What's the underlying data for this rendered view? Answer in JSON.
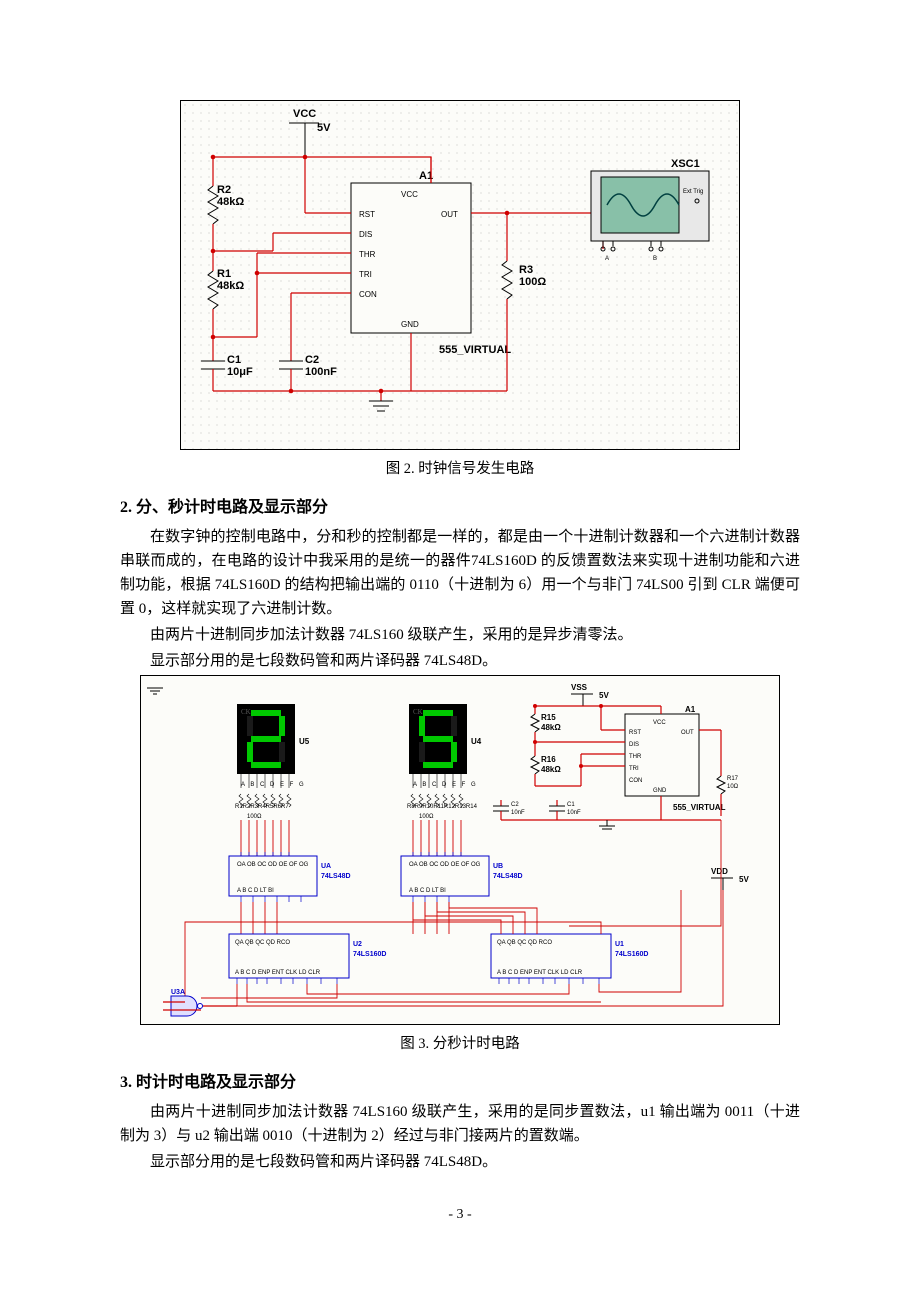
{
  "fig1": {
    "vcc": "VCC",
    "vcc_val": "5V",
    "r2_name": "R2",
    "r2_val": "48kΩ",
    "r1_name": "R1",
    "r1_val": "48kΩ",
    "c1_name": "C1",
    "c1_val": "10μF",
    "c2_name": "C2",
    "c2_val": "100nF",
    "a1": "A1",
    "r3_name": "R3",
    "r3_val": "100Ω",
    "chip_vcc": "VCC",
    "chip_rst": "RST",
    "chip_out": "OUT",
    "chip_dis": "DIS",
    "chip_thr": "THR",
    "chip_tri": "TRI",
    "chip_con": "CON",
    "chip_gnd": "GND",
    "chip_model": "555_VIRTUAL",
    "scope": "XSC1",
    "scope_ext": "Ext Trig",
    "scope_a": "A",
    "scope_b": "B",
    "caption": "图 2. 时钟信号发生电路"
  },
  "sec2": {
    "heading": "2. 分、秒计时电路及显示部分",
    "p1": "在数字钟的控制电路中，分和秒的控制都是一样的，都是由一个十进制计数器和一个六进制计数器串联而成的，在电路的设计中我采用的是统一的器件74LS160D 的反馈置数法来实现十进制功能和六进制功能，根据 74LS160D 的结构把输出端的 0110（十进制为 6）用一个与非门 74LS00 引到 CLR 端便可置 0，这样就实现了六进制计数。",
    "p2": "由两片十进制同步加法计数器 74LS160 级联产生，采用的是异步清零法。",
    "p3": "显示部分用的是七段数码管和两片译码器 74LS48D。"
  },
  "fig2": {
    "vss": "VSS",
    "vss_val": "5V",
    "vdd": "VDD",
    "vdd_val": "5V",
    "u5": "U5",
    "u4": "U4",
    "r15_name": "R15",
    "r15_val": "48kΩ",
    "r16_name": "R16",
    "r16_val": "48kΩ",
    "r17": "R17",
    "r17_val": "10Ω",
    "a1": "A1",
    "c1_name": "C1",
    "c1_val": "10nF",
    "c2_name": "C2",
    "c2_val": "10nF",
    "chip555": "555_VIRTUAL",
    "chip_pins": {
      "vcc": "VCC",
      "rst": "RST",
      "out": "OUT",
      "dis": "DIS",
      "thr": "THR",
      "tri": "TRI",
      "con": "CON",
      "gnd": "GND"
    },
    "rgroup1": "R8R9R10R11R12R13R14",
    "rgroup1_val": "100Ω",
    "rgroup2": "R1R2R3R4R5R6R7",
    "rgroup2_val": "100Ω",
    "ua": "UA",
    "ub": "UB",
    "dec": "74LS48D",
    "u1": "U1",
    "u2": "U2",
    "cnt": "74LS160D",
    "u3a": "U3A",
    "seg_pins": "A B C D E F G",
    "caption": "图 3. 分秒计时电路"
  },
  "sec3": {
    "heading": "3. 时计时电路及显示部分",
    "p1": "由两片十进制同步加法计数器 74LS160 级联产生，采用的是同步置数法，u1 输出端为 0011（十进制为 3）与 u2 输出端 0010（十进制为 2）经过与非门接两片的置数端。",
    "p2": "显示部分用的是七段数码管和两片译码器 74LS48D。"
  },
  "page_number": "- 3 -"
}
